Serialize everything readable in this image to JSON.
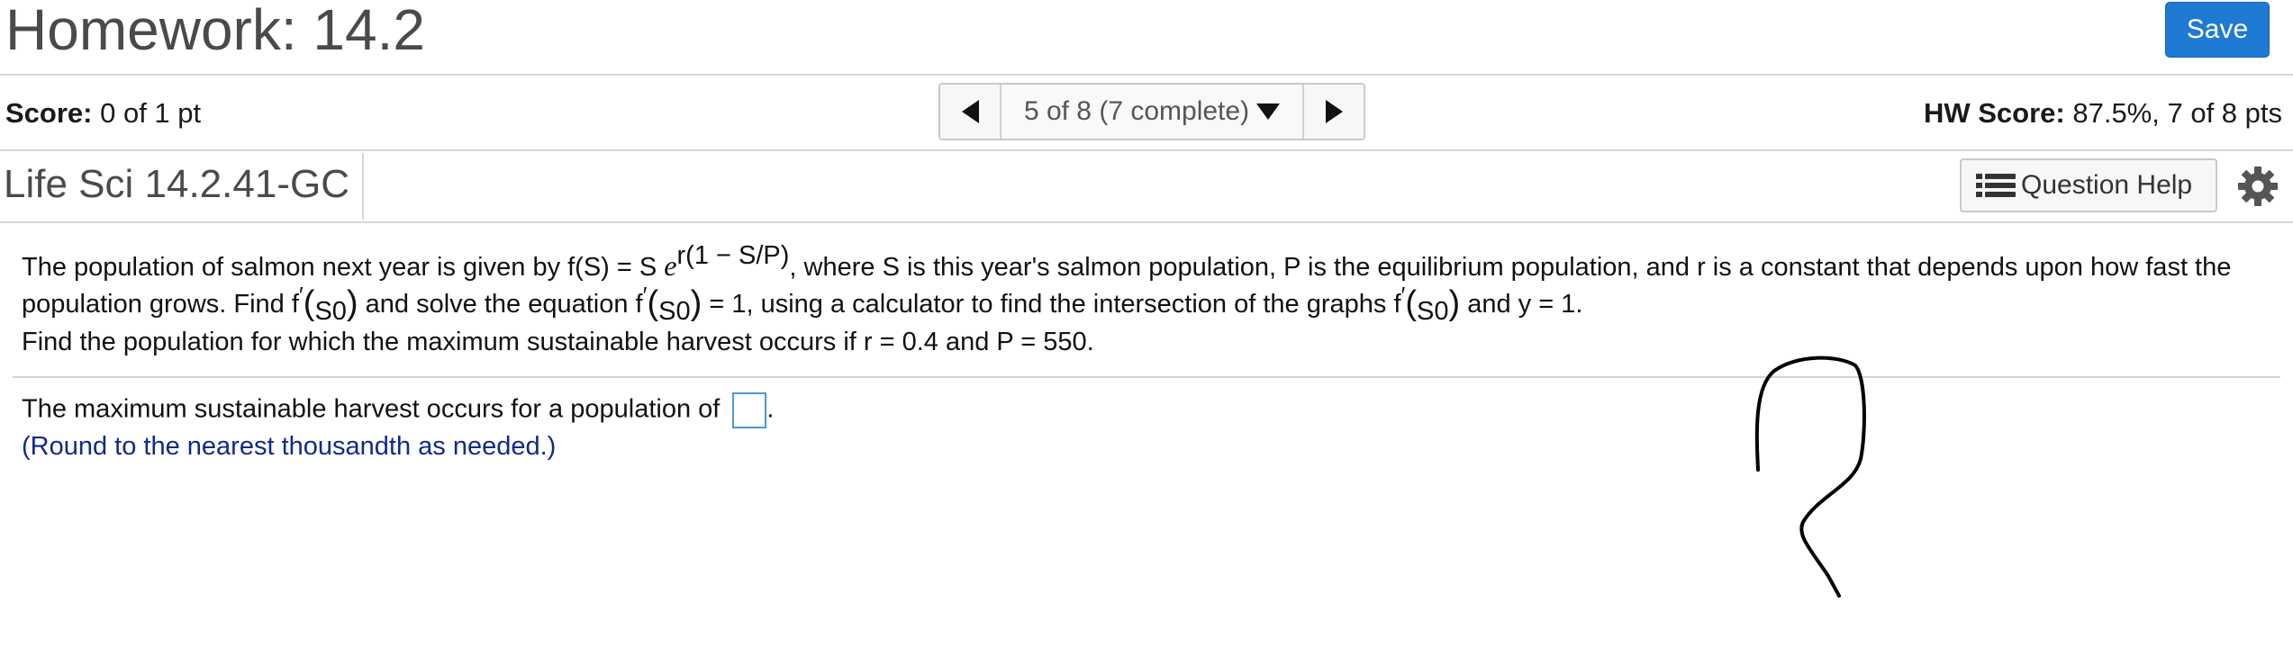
{
  "header": {
    "title": "Homework: 14.2",
    "save_label": "Save"
  },
  "scorebar": {
    "score_label": "Score:",
    "score_value": "0 of 1 pt",
    "nav_text": "5 of 8 (7 complete)",
    "hw_label": "HW Score:",
    "hw_value": "87.5%, 7 of 8 pts"
  },
  "question": {
    "id": "Life Sci 14.2.41-GC",
    "help_label": "Question Help"
  },
  "problem": {
    "p1_a": "The population of salmon next year is given by f(S) = S",
    "p1_e": "e",
    "p1_exp": "r(1 − S/P)",
    "p1_b": ", where S is this year's salmon population, P is the equilibrium population, and r is a constant that depends upon how fast the population grows.  Find f",
    "prime": "′",
    "s0": "S0",
    "p1_c": "and solve the equation f",
    "p1_d": "= 1, using a calculator to find the intersection of the graphs f",
    "p1_e2": "and y = 1.",
    "p2": "Find the population for which the maximum sustainable harvest occurs if r = 0.4 and P = 550."
  },
  "answer": {
    "text": "The maximum sustainable harvest occurs for a population of",
    "value": "",
    "end": "."
  },
  "hint": "(Round to the nearest thousandth as needed.)",
  "colors": {
    "save": "#1e7ad2",
    "hint": "#0f2a8a",
    "answer_border": "#4a98d9"
  }
}
